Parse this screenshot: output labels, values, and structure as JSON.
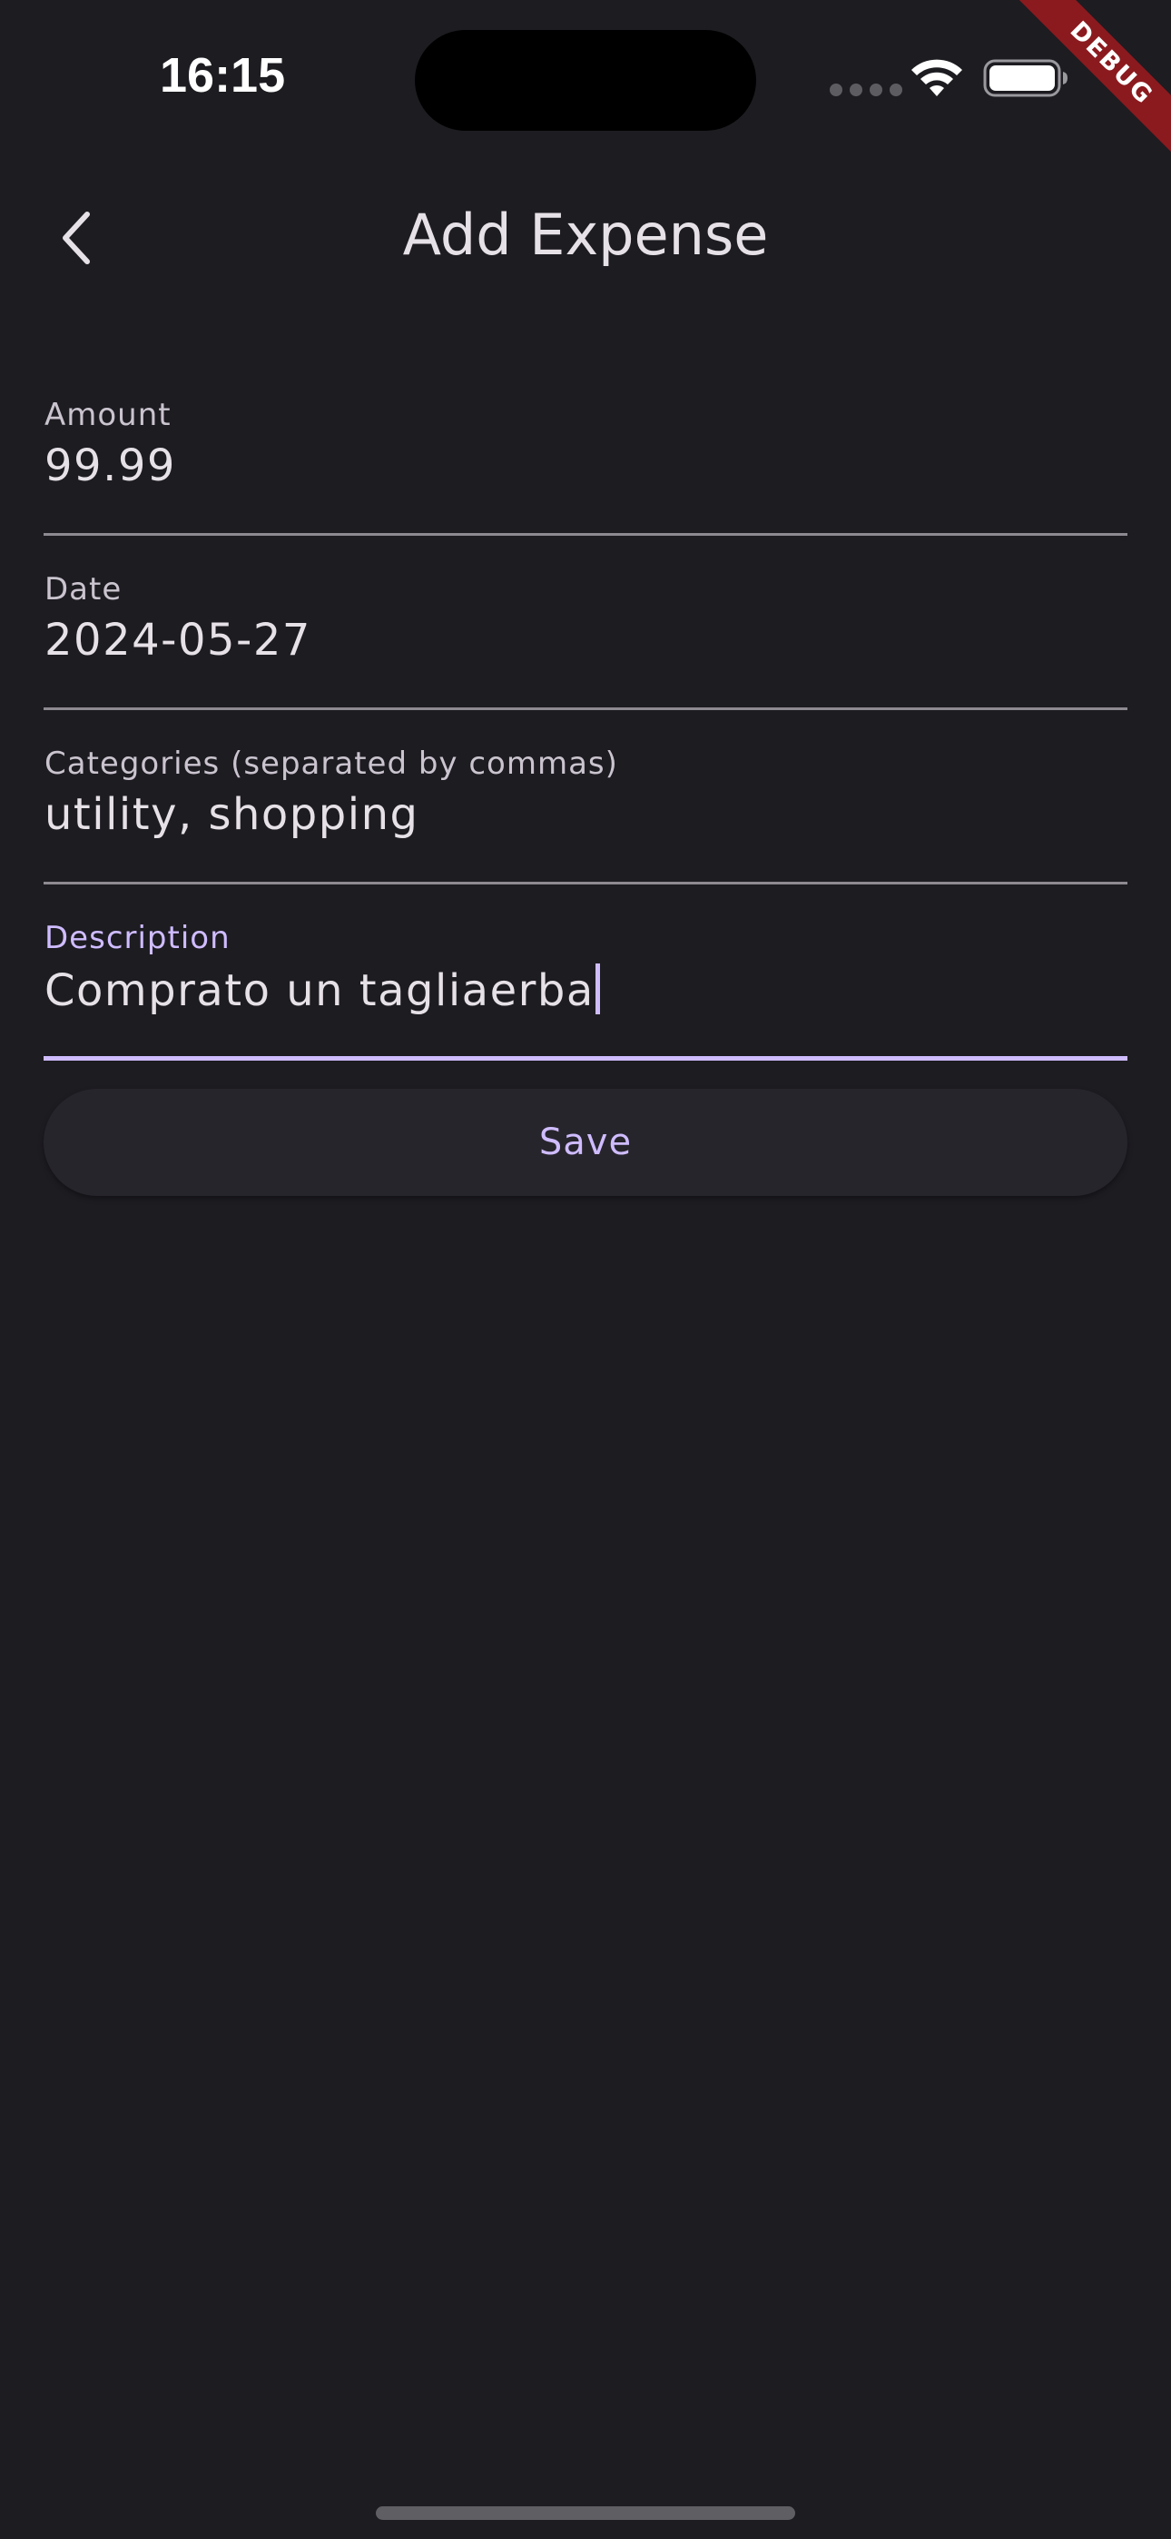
{
  "status_bar": {
    "time": "16:15"
  },
  "debug_banner": {
    "label": "DEBUG",
    "color": "#8b1a1f"
  },
  "app_bar": {
    "title": "Add Expense",
    "back_icon": "chevron-left-icon"
  },
  "form": {
    "amount": {
      "label": "Amount",
      "value": "99.99"
    },
    "date": {
      "label": "Date",
      "value": "2024-05-27"
    },
    "categories": {
      "label": "Categories (separated by commas)",
      "value": "utility, shopping"
    },
    "description": {
      "label": "Description",
      "value": "Comprato un tagliaerba",
      "focused": true
    },
    "save_label": "Save"
  },
  "theme": {
    "background": "#1d1c21",
    "accent": "#cfbcff",
    "text": "#e6e1e6",
    "muted_text": "#cac4cf",
    "underline": "#8e8a91",
    "button_surface": "#27252c"
  }
}
